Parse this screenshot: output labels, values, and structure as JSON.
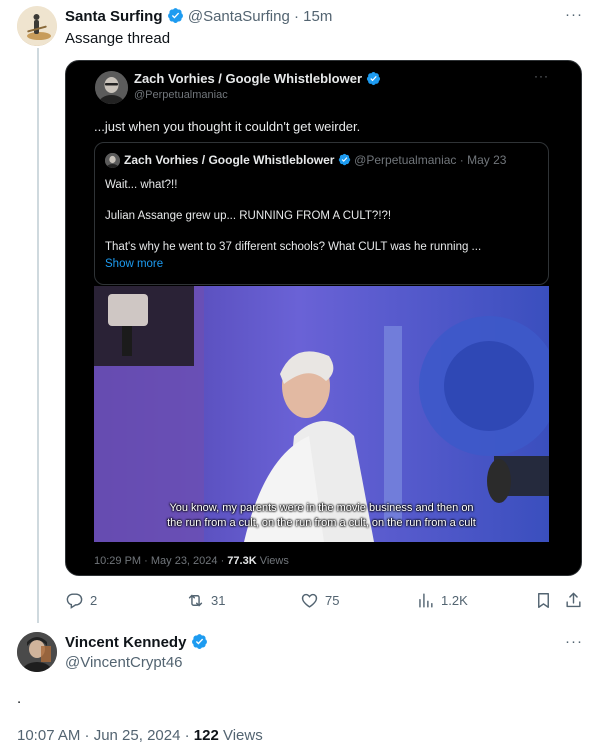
{
  "top_tweet": {
    "author_name": "Santa Surfing",
    "author_handle": "@SantaSurfing",
    "time": "· 15m",
    "text": "Assange thread",
    "more_icon": "more-horizontal-icon"
  },
  "embedded_tweet": {
    "author_name": "Zach Vorhies / Google Whistleblower",
    "author_handle": "@Perpetualmaniac",
    "text": "...just when you thought it couldn't get weirder.",
    "quoted": {
      "author_name": "Zach Vorhies / Google Whistleblower",
      "author_handle": "@Perpetualmaniac",
      "date": "· May 23",
      "line1": "Wait... what?!!",
      "line2": "Julian Assange grew up... RUNNING FROM A CULT?!?!",
      "line3": "That's why he went to 37 different schools? What CULT was he running ...",
      "show_more": "Show more"
    },
    "video_caption_line1": "You know, my parents were in the movie business and then on",
    "video_caption_line2": "the run from a cult, on the run from a cult, on the run from a cult",
    "footer_time": "10:29 PM · May 23, 2024 · ",
    "footer_views_count": "77.3K",
    "footer_views_label": " Views"
  },
  "actions": {
    "reply_count": "2",
    "retweet_count": "31",
    "like_count": "75",
    "views_count": "1.2K"
  },
  "reply_tweet": {
    "author_name": "Vincent Kennedy",
    "author_handle": "@VincentCrypt46",
    "text": ".",
    "timestamp": "10:07 AM · Jun 25, 2024 · ",
    "views_count": "122",
    "views_label": " Views"
  },
  "colors": {
    "verified_blue": "#1d9bf0",
    "dark_card": "#000000",
    "muted_text": "#536471"
  }
}
